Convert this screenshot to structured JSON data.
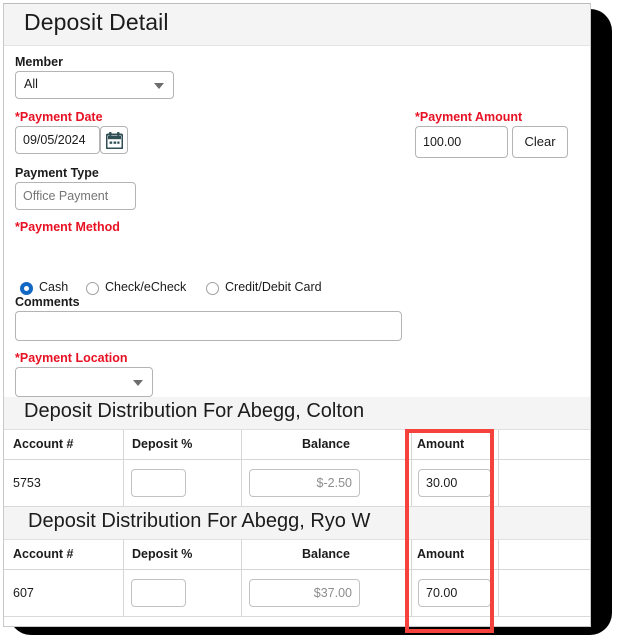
{
  "window": {
    "title": "Deposit Detail"
  },
  "form": {
    "member": {
      "label": "Member",
      "value": "All",
      "caret_icon": "chevron-down-icon"
    },
    "payment_date": {
      "label": "*Payment Date",
      "value": "09/05/2024",
      "calendar_icon": "calendar-icon"
    },
    "payment_amount": {
      "label": "*Payment Amount",
      "value": "100.00",
      "clear_label": "Clear"
    },
    "payment_type": {
      "label": "Payment Type",
      "placeholder": "Office Payment",
      "value": ""
    },
    "payment_method": {
      "label": "*Payment Method",
      "options": [
        {
          "label": "Cash",
          "selected": true
        },
        {
          "label": "Check/eCheck",
          "selected": false
        },
        {
          "label": "Credit/Debit Card",
          "selected": false
        }
      ]
    },
    "comments": {
      "label": "Comments",
      "value": ""
    },
    "payment_location": {
      "label": "*Payment Location",
      "value": "",
      "caret_icon": "chevron-down-icon"
    }
  },
  "distributions": [
    {
      "section_title": "Deposit Distribution For Abegg, Colton",
      "columns": [
        "Account #",
        "Deposit %",
        "Balance",
        "Amount"
      ],
      "rows": [
        {
          "account": "5753",
          "deposit_pct": "",
          "balance": "$-2.50",
          "amount": "30.00"
        }
      ]
    },
    {
      "section_title": "Deposit Distribution For Abegg, Ryo W",
      "columns": [
        "Account #",
        "Deposit %",
        "Balance",
        "Amount"
      ],
      "rows": [
        {
          "account": "607",
          "deposit_pct": "",
          "balance": "$37.00",
          "amount": "70.00"
        }
      ]
    }
  ],
  "annotation": {
    "highlight_color": "#f4433c",
    "target": "Amount column"
  },
  "colors": {
    "required_label": "#e81123",
    "title_bar": "#f4f4f4",
    "radio_selected": "#1268c3"
  }
}
